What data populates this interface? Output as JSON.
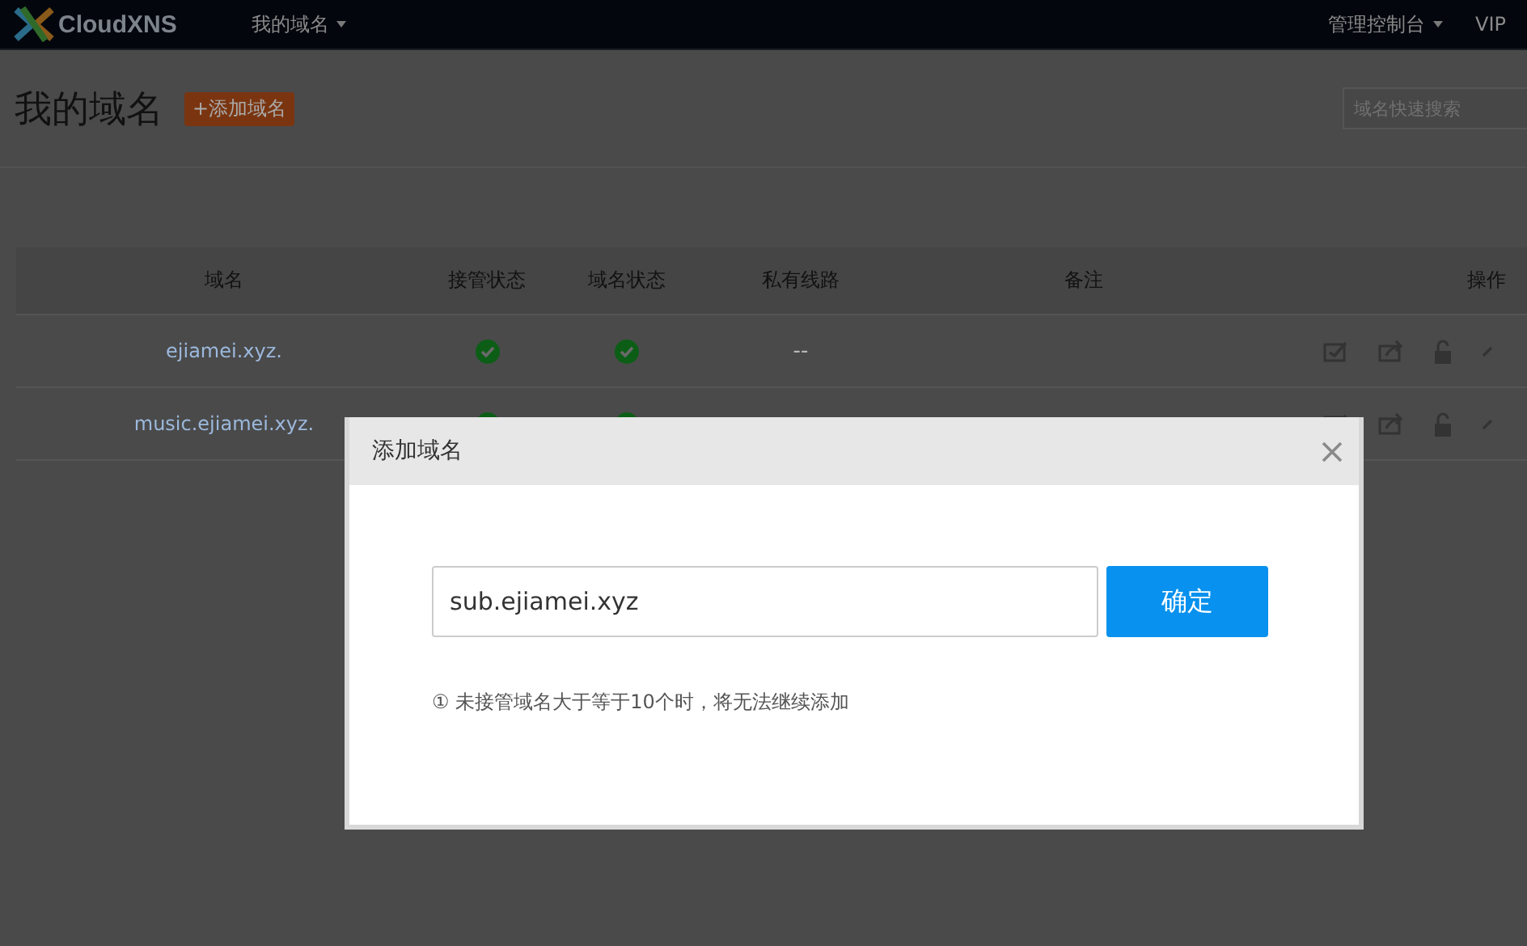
{
  "navbar": {
    "logo": "CloudXNS",
    "menu": [
      {
        "label": "我的域名",
        "dropdown": true
      }
    ],
    "right_menu": [
      {
        "label": "管理控制台",
        "dropdown": true
      },
      {
        "label": "VIP",
        "dropdown": false
      }
    ]
  },
  "header": {
    "title": "我的域名",
    "add_button": "+添加域名",
    "search": {
      "placeholder": "域名快速搜索"
    }
  },
  "table": {
    "columns": [
      "域名",
      "接管状态",
      "域名状态",
      "私有线路",
      "备注",
      "操作"
    ],
    "rows": [
      {
        "domain": "ejiamei.xyz.",
        "takeover_ok": true,
        "status_ok": true,
        "private_line": "--"
      },
      {
        "domain": "music.ejiamei.xyz.",
        "takeover_ok": true,
        "status_ok": true
      }
    ]
  },
  "dialog": {
    "title": "添加域名",
    "input": {
      "value": "sub.ejiamei.xyz"
    },
    "confirm": "确定",
    "note": "① 未接管域名大于等于10个时，将无法继续添加"
  }
}
